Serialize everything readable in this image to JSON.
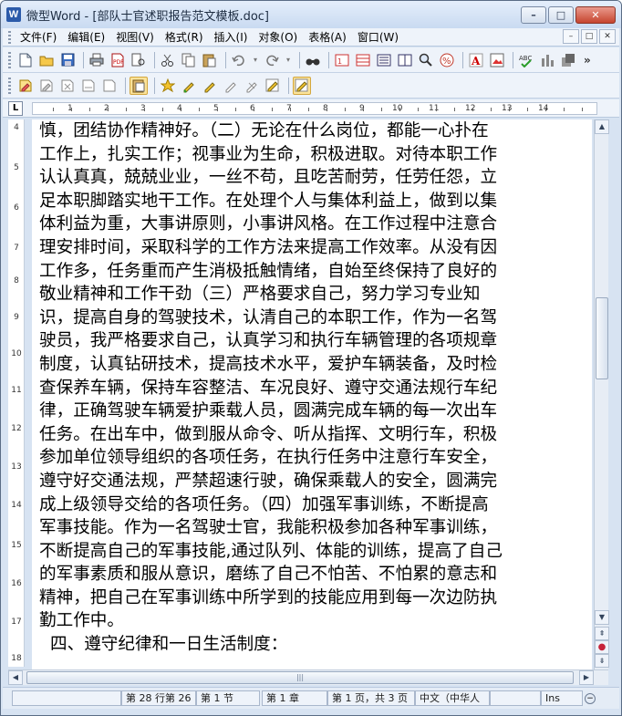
{
  "window": {
    "title": "微型Word - [部队士官述职报告范文模板.doc]",
    "app_icon_letter": "W",
    "controls": {
      "minimize": "–",
      "maximize": "□",
      "close": "✕"
    }
  },
  "menubar": {
    "items": [
      "文件(F)",
      "编辑(E)",
      "视图(V)",
      "格式(R)",
      "插入(I)",
      "对象(O)",
      "表格(A)",
      "窗口(W)"
    ],
    "doc_controls": [
      "–",
      "□",
      "✕"
    ]
  },
  "toolbar1": {
    "buttons": [
      "new-doc-icon",
      "open-icon",
      "save-icon",
      "print-icon",
      "pdf-icon",
      "cut-icon",
      "copy-icon",
      "paste-icon",
      "undo-icon",
      "redo-icon",
      "find-icon",
      "table-1-icon",
      "table-2-icon",
      "page-icon",
      "page-2-icon",
      "zoom-icon",
      "percent-icon",
      "text-color-icon",
      "image-icon",
      "spellcheck-icon",
      "chart-icon",
      "shape-icon"
    ],
    "more": "»"
  },
  "toolbar2": {
    "buttons": [
      "format-1-icon",
      "format-2-icon",
      "format-3-icon",
      "format-4-icon",
      "format-5-icon",
      "clipboard-icon",
      "highlight-1-icon",
      "highlight-2-icon",
      "highlight-3-icon",
      "highlight-4-icon",
      "edit-1-icon",
      "edit-2-icon"
    ]
  },
  "ruler": {
    "corner": "L",
    "numbers": [
      "1",
      "2",
      "3",
      "4",
      "5",
      "6",
      "7",
      "8",
      "9",
      "10",
      "11",
      "12",
      "13",
      "14"
    ]
  },
  "vruler": {
    "numbers": [
      "4",
      "5",
      "6",
      "7",
      "8",
      "9",
      "10",
      "11",
      "12",
      "13",
      "14",
      "15",
      "16",
      "17",
      "18"
    ]
  },
  "document": {
    "lines": [
      "慎，团结协作精神好。（二）无论在什么岗位，都能一心扑在",
      "工作上，扎实工作；视事业为生命，积极进取。对待本职工作",
      "认认真真，兢兢业业，一丝不苟，且吃苦耐劳，任劳任怨，立",
      "足本职脚踏实地干工作。在处理个人与集体利益上，做到以集",
      "体利益为重，大事讲原则，小事讲风格。在工作过程中注意合",
      "理安排时间，采取科学的工作方法来提高工作效率。从没有因",
      "工作多，任务重而产生消极抵触情绪，自始至终保持了良好的",
      "敬业精神和工作干劲（三）严格要求自己，努力学习专业知",
      "识，提高自身的驾驶技术，认清自己的本职工作，作为一名驾",
      "驶员，我严格要求自己，认真学习和执行车辆管理的各项规章",
      "制度，认真钻研技术，提高技术水平，爱护车辆装备，及时检",
      "查保养车辆，保持车容整洁、车况良好、遵守交通法规行车纪",
      "律，正确驾驶车辆爱护乘载人员，圆满完成车辆的每一次出车",
      "任务。在出车中，做到服从命令、听从指挥、文明行车，积极",
      "参加单位领导组织的各项任务，在执行任务中注意行车安全，",
      "遵守好交通法规，严禁超速行驶，确保乘载人的安全，圆满完",
      "成上级领导交给的各项任务。（四）加强军事训练，不断提高",
      "军事技能。作为一名驾驶士官，我能积极参加各种军事训练，",
      "不断提高自己的军事技能,通过队列、体能的训练，提高了自己",
      "的军事素质和服从意识，磨练了自己不怕苦、不怕累的意志和",
      "精神，把自己在军事训练中所学到的技能应用到每一次边防执",
      "勤工作中。"
    ],
    "heading": "四、遵守纪律和一日生活制度："
  },
  "scrollbar": {
    "up": "▲",
    "down": "▼",
    "prev_page": "⇞",
    "browse": "●",
    "next_page": "⇟",
    "left": "◀",
    "right": "▶",
    "grip": "|||"
  },
  "statusbar": {
    "position": "第 28 行第 26",
    "section": "第 1 节",
    "chapter": "第 1 章",
    "page": "第 1 页，共 3 页",
    "language": "中文（中华人",
    "mode": "Ins",
    "zoom_glyph": "−"
  }
}
